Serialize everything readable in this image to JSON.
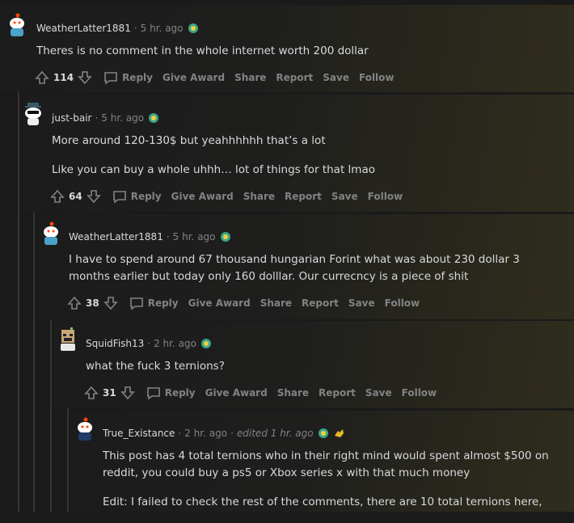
{
  "comments": [
    {
      "username": "WeatherLatter1881",
      "time": "5 hr. ago",
      "paragraphs": [
        "Theres is no comment in the whole internet worth 200 dollar"
      ],
      "score": "114"
    },
    {
      "username": "just-bair",
      "time": "5 hr. ago",
      "paragraphs": [
        "More around 120-130$ but yeahhhhhh that’s a lot",
        "Like you can buy a whole uhhh… lot of things for that lmao"
      ],
      "score": "64"
    },
    {
      "username": "WeatherLatter1881",
      "time": "5 hr. ago",
      "paragraphs": [
        "I have to spend around 67 thousand hungarian Forint what was about 230 dollar 3 months earlier but today only 160 dolllar. Our currecncy is a piece of shit"
      ],
      "score": "38"
    },
    {
      "username": "SquidFish13",
      "time": "2 hr. ago",
      "paragraphs": [
        "what the fuck 3 ternions?"
      ],
      "score": "31"
    },
    {
      "username": "True_Existance",
      "time": "2 hr. ago",
      "edited": "edited 1 hr. ago",
      "paragraphs": [
        "This post has 4 total ternions who in their right mind would spent almost $500 on reddit, you could buy a ps5 or Xbox series x with that much money",
        "Edit: I failed to check the rest of the comments, there are 10 total ternions here,"
      ]
    }
  ],
  "actions": {
    "reply": "Reply",
    "give_award": "Give Award",
    "share": "Share",
    "report": "Report",
    "save": "Save",
    "follow": "Follow"
  },
  "icons": {
    "upvote": "upvote-arrow-icon",
    "downvote": "downvote-arrow-icon",
    "reply": "chat-bubble-icon",
    "award": "ternion-award-icon",
    "award2": "gold-hands-award-icon"
  },
  "colors": {
    "background": "#1a1a1b",
    "text": "#d7dadc",
    "muted": "#818384",
    "thread_line": "#343536"
  }
}
